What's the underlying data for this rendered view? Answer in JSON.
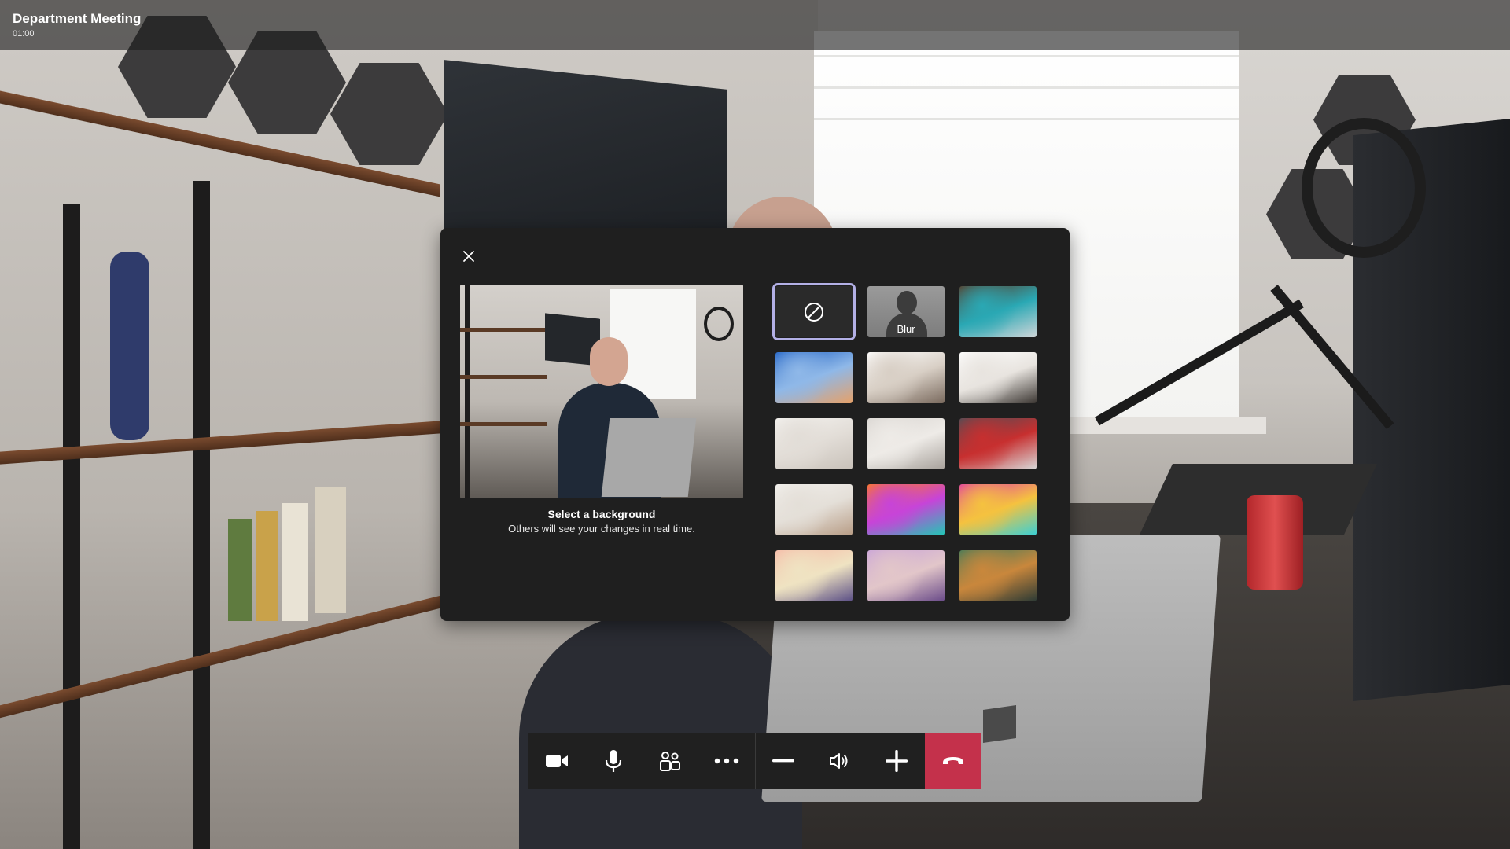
{
  "meeting": {
    "title": "Department Meeting",
    "timer": "01:00"
  },
  "background_panel": {
    "close_icon": "close-icon",
    "preview_title": "Select a background",
    "preview_subtitle": "Others will see your changes in real time.",
    "selected_index": 0,
    "options": [
      {
        "type": "none",
        "label": "",
        "icon": "no-background-icon"
      },
      {
        "type": "blur",
        "label": "Blur"
      },
      {
        "type": "image",
        "label": "",
        "colors": [
          "#5a3a26",
          "#2aa8b4",
          "#cfd5d8"
        ]
      },
      {
        "type": "image",
        "label": "",
        "colors": [
          "#1f61c4",
          "#8fb8e8",
          "#e6a169"
        ]
      },
      {
        "type": "image",
        "label": "",
        "colors": [
          "#ffffff",
          "#d8cfc5",
          "#7a6a5e"
        ]
      },
      {
        "type": "image",
        "label": "",
        "colors": [
          "#ffffff",
          "#e8e4df",
          "#3b3632"
        ]
      },
      {
        "type": "image",
        "label": "",
        "colors": [
          "#f4f2ef",
          "#e2ddd7",
          "#c9c2ba"
        ]
      },
      {
        "type": "image",
        "label": "",
        "colors": [
          "#d9d5d1",
          "#eeebe7",
          "#a8a29c"
        ]
      },
      {
        "type": "image",
        "label": "",
        "colors": [
          "#4a4f57",
          "#c72f2f",
          "#d8d8d8"
        ]
      },
      {
        "type": "image",
        "label": "",
        "colors": [
          "#f3f1ee",
          "#e4dfd8",
          "#b89d86"
        ]
      },
      {
        "type": "image",
        "label": "",
        "colors": [
          "#ff7b1c",
          "#c744d8",
          "#21c7b5"
        ]
      },
      {
        "type": "image",
        "label": "",
        "colors": [
          "#e03aa6",
          "#f5c23f",
          "#3ad0d6"
        ]
      },
      {
        "type": "image",
        "label": "",
        "colors": [
          "#f7b9a7",
          "#efe3c2",
          "#5b4f86"
        ]
      },
      {
        "type": "image",
        "label": "",
        "colors": [
          "#c9a3d9",
          "#e2c6c9",
          "#6a4b89"
        ]
      },
      {
        "type": "image",
        "label": "",
        "colors": [
          "#3f7a5a",
          "#c9873c",
          "#2c3a35"
        ]
      }
    ]
  },
  "controls": [
    {
      "name": "camera-button",
      "icon": "video-camera-icon"
    },
    {
      "name": "microphone-button",
      "icon": "microphone-icon"
    },
    {
      "name": "participants-button",
      "icon": "people-icon"
    },
    {
      "name": "more-options-button",
      "icon": "more-icon"
    },
    {
      "name": "volume-down-button",
      "icon": "minus-icon"
    },
    {
      "name": "volume-button",
      "icon": "speaker-icon"
    },
    {
      "name": "volume-up-button",
      "icon": "plus-icon"
    },
    {
      "name": "hang-up-button",
      "icon": "hang-up-icon"
    }
  ],
  "colors": {
    "hangup": "#c4314b",
    "selection_outline": "#b3b0e6",
    "panel_bg": "#1f1f1f",
    "controls_bg": "#202020"
  }
}
